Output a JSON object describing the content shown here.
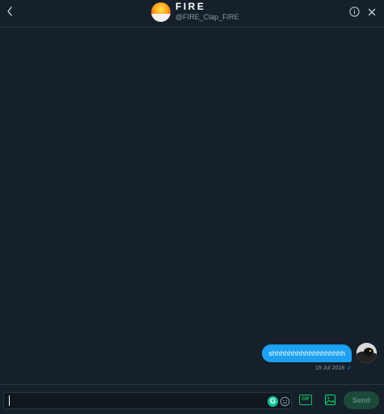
{
  "header": {
    "title": "FIRE",
    "handle": "@FIRE_Clap_FIRE"
  },
  "conversation": {
    "messages": [
      {
        "text": "shhhhhhhhhhhhhhhhhh",
        "date": "19 Jul 2018",
        "status_icon": "checkmark-icon",
        "status_glyph": "✓"
      }
    ]
  },
  "composer": {
    "grammarly_letter": "G",
    "gif_label": "GIF",
    "send_label": "Send"
  },
  "icons": {
    "back": "chevron-left-icon",
    "info": "info-icon",
    "close": "close-icon",
    "emoji": "emoji-icon",
    "gif": "gif-icon",
    "media": "image-icon"
  },
  "colors": {
    "background": "#15202b",
    "accent": "#1da1f2",
    "composer_accent": "#17bf63",
    "send_disabled": "#1c4a3a"
  }
}
